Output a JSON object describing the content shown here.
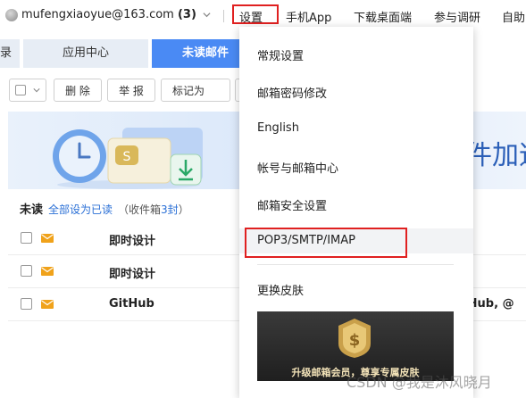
{
  "header": {
    "account_name": "mufengxiaoyue@163.com",
    "account_count": "(3)",
    "links": [
      {
        "label": "设置"
      },
      {
        "label": "手机App"
      },
      {
        "label": "下载桌面端"
      },
      {
        "label": "参与调研"
      },
      {
        "label": "自助"
      }
    ]
  },
  "tabs": [
    {
      "label": "录"
    },
    {
      "label": "应用中心"
    },
    {
      "label": "未读邮件"
    }
  ],
  "toolbar": {
    "delete_label": "删 除",
    "report_label": "举 报",
    "mark_label": "标记为"
  },
  "banner": {
    "text": "件加速"
  },
  "unread_summary": {
    "title": "未读",
    "mark_all_read": "全部设为已读",
    "inbox_prefix": "（收件箱",
    "inbox_count": "3封",
    "inbox_suffix": "）"
  },
  "mails": [
    {
      "sender": "即时设计",
      "preview": ""
    },
    {
      "sender": "即时设计",
      "preview": ""
    },
    {
      "sender": "GitHub",
      "preview": "itHub, @"
    }
  ],
  "settings_menu": {
    "items": [
      {
        "label": "常规设置"
      },
      {
        "label": "邮箱密码修改"
      },
      {
        "label": "English"
      },
      {
        "label": "帐号与邮箱中心"
      },
      {
        "label": "邮箱安全设置"
      },
      {
        "label": "POP3/SMTP/IMAP"
      },
      {
        "label": "更换皮肤"
      }
    ],
    "promo_text": "升级邮箱会员，尊享专属皮肤"
  },
  "watermark": "CSDN @我是沐风晓月",
  "colors": {
    "accent": "#4a8af4",
    "highlight_box": "#e02020",
    "link": "#2a6fd6",
    "envelope": "#f0a21a"
  }
}
